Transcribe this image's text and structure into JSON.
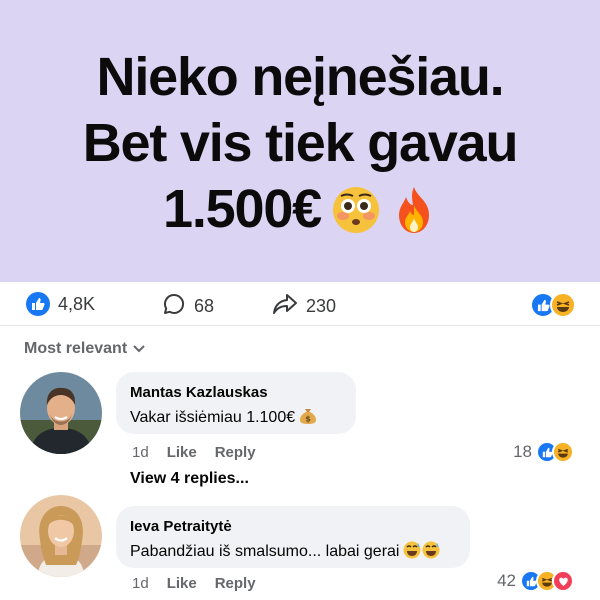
{
  "post": {
    "headline_line1": "Nieko neįnešiau.",
    "headline_line2": "Bet vis tiek gavau",
    "headline_line3": "1.500€",
    "headline_emojis": [
      "flushed-face",
      "fire"
    ],
    "background_color": "#dcd4f3"
  },
  "stats": {
    "likes": "4,8K",
    "comments": "68",
    "shares": "230",
    "reactions": [
      "like",
      "haha"
    ]
  },
  "sort": {
    "label": "Most relevant"
  },
  "comments": [
    {
      "author": "Mantas Kazlauskas",
      "text": "Vakar išsiėmiau 1.100€",
      "emoji": "money-bag",
      "time": "1d",
      "like_label": "Like",
      "reply_label": "Reply",
      "reaction_count": "18",
      "reactions": [
        "like",
        "haha"
      ],
      "replies_link": "View 4 replies..."
    },
    {
      "author": "Ieva Petraitytė",
      "text": "Pabandžiau iš smalsumo... labai gerai",
      "emoji": "grinning-sweat-x2",
      "time": "1d",
      "like_label": "Like",
      "reply_label": "Reply",
      "reaction_count": "42",
      "reactions": [
        "like",
        "haha",
        "love"
      ]
    }
  ],
  "colors": {
    "like": "#1877f2",
    "haha": "#f7b125",
    "love": "#f33e58",
    "bubble": "#f0f2f5",
    "meta_text": "#65676b"
  }
}
